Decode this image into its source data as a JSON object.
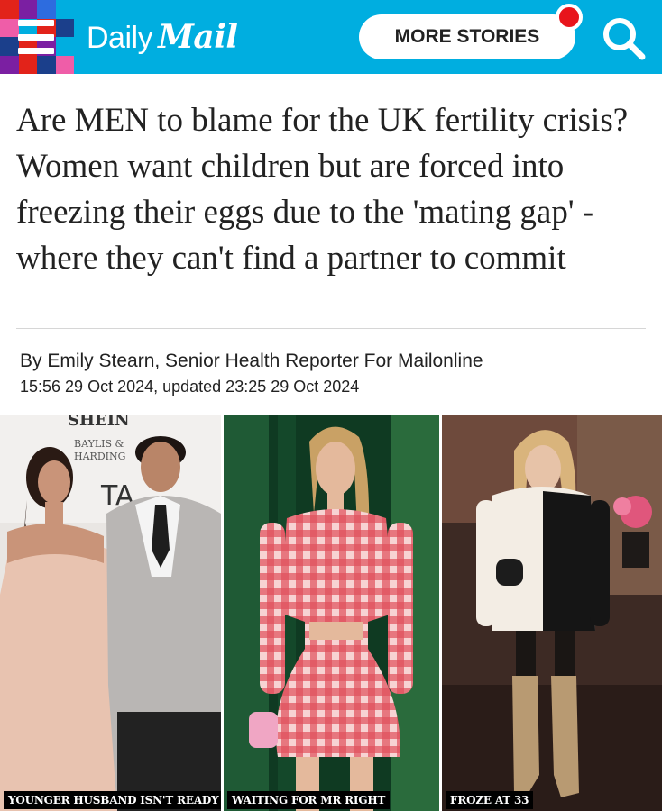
{
  "header": {
    "logo_daily": "Daily",
    "logo_mail": "Mail",
    "more_stories_label": "MORE STORIES",
    "colors": {
      "bar": "#00aee0",
      "notification": "#e8141b"
    },
    "icons": [
      "hamburger-menu-icon",
      "search-icon",
      "notification-dot"
    ]
  },
  "article": {
    "headline": "Are MEN to blame for the UK fertility crisis? Women want children but are forced into freezing their eggs due to the 'mating gap' - where they can't find a partner to commit",
    "byline": "By Emily Stearn, Senior Health Reporter For Mailonline",
    "dateline": "15:56 29 Oct 2024, updated 23:25 29 Oct 2024"
  },
  "photos": [
    {
      "caption": "YOUNGER HUSBAND ISN'T READY",
      "backdrop_text": [
        "SHEIN",
        "BAYLIS &",
        "HARDING",
        "TA"
      ]
    },
    {
      "caption": "WAITING FOR MR RIGHT"
    },
    {
      "caption": "FROZE AT 33"
    }
  ]
}
